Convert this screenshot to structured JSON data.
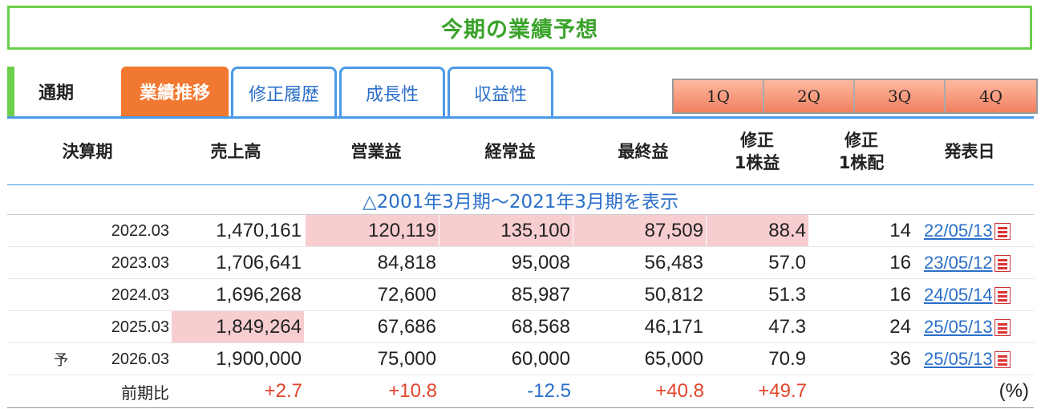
{
  "page_title": "今期の業績予想",
  "tabs": {
    "period": "通期",
    "active": "業績推移",
    "links": [
      "修正履歴",
      "成長性",
      "収益性"
    ],
    "quarters": [
      "1Q",
      "2Q",
      "3Q",
      "4Q"
    ]
  },
  "headers": {
    "period": "決算期",
    "sales": "売上高",
    "op": "営業益",
    "ord": "経常益",
    "net": "最終益",
    "eps_top": "修正",
    "eps_bottom": "1株益",
    "div_top": "修正",
    "div_bottom": "1株配",
    "date": "発表日"
  },
  "show_older": "△2001年3月期～2021年3月期を表示",
  "rows": [
    {
      "prefix": "",
      "period": "2022.03",
      "sales": "1,470,161",
      "op": "120,119",
      "ord": "135,100",
      "net": "87,509",
      "eps": "88.4",
      "div": "14",
      "date": "22/05/13"
    },
    {
      "prefix": "",
      "period": "2023.03",
      "sales": "1,706,641",
      "op": "84,818",
      "ord": "95,008",
      "net": "56,483",
      "eps": "57.0",
      "div": "16",
      "date": "23/05/12"
    },
    {
      "prefix": "",
      "period": "2024.03",
      "sales": "1,696,268",
      "op": "72,600",
      "ord": "85,987",
      "net": "50,812",
      "eps": "51.3",
      "div": "16",
      "date": "24/05/14"
    },
    {
      "prefix": "",
      "period": "2025.03",
      "sales": "1,849,264",
      "op": "67,686",
      "ord": "68,568",
      "net": "46,171",
      "eps": "47.3",
      "div": "24",
      "date": "25/05/13"
    },
    {
      "prefix": "予",
      "period": "2026.03",
      "sales": "1,900,000",
      "op": "75,000",
      "ord": "60,000",
      "net": "65,000",
      "eps": "70.9",
      "div": "36",
      "date": "25/05/13"
    }
  ],
  "comparison": {
    "label": "前期比",
    "sales": "+2.7",
    "op": "+10.8",
    "ord": "-12.5",
    "net": "+40.8",
    "eps": "+49.7",
    "unit": "(%)"
  },
  "colors": {
    "highlight": "#f7cdd0",
    "positive": "#e2452a",
    "negative": "#2a6fc9",
    "tab_active": "#f07830",
    "accent_green": "#6ccf4c",
    "accent_blue": "#4b9ae8"
  }
}
